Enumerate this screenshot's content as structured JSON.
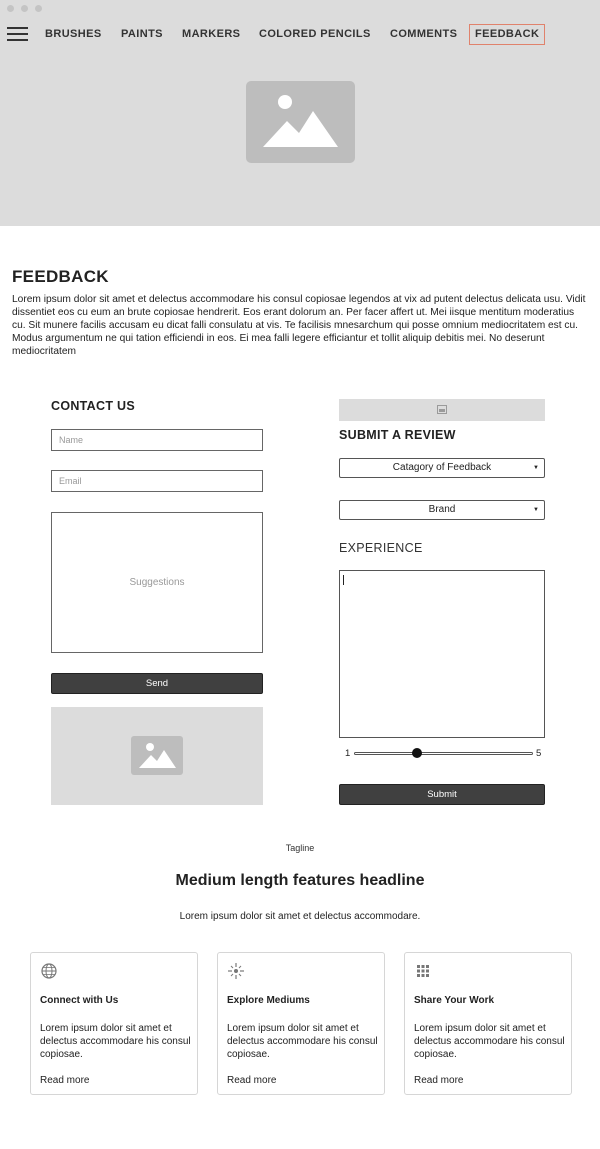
{
  "nav": {
    "items": [
      {
        "label": "BRUSHES"
      },
      {
        "label": "PAINTS"
      },
      {
        "label": "MARKERS"
      },
      {
        "label": "COLORED PENCILS"
      },
      {
        "label": "COMMENTS"
      },
      {
        "label": "FEEDBACK",
        "active": true
      }
    ]
  },
  "page": {
    "title": "FEEDBACK",
    "intro": "Lorem ipsum dolor sit amet et delectus accommodare his consul copiosae legendos at vix ad putent delectus delicata usu. Vidit dissentiet eos cu eum an brute copiosae hendrerit. Eos erant dolorum an. Per facer affert ut. Mei iisque mentitum moderatius cu. Sit munere facilis accusam eu dicat falli consulatu at vis. Te facilisis mnesarchum qui posse omnium mediocritatem est cu. Modus argumentum ne qui tation efficiendi in eos. Ei mea falli legere efficiantur et tollit aliquip debitis mei. No deserunt mediocritatem"
  },
  "contact": {
    "heading": "CONTACT US",
    "name_placeholder": "Name",
    "email_placeholder": "Email",
    "suggestions_placeholder": "Suggestions",
    "send_label": "Send"
  },
  "review": {
    "heading": "SUBMIT A REVIEW",
    "category_select": "Catagory of Feedback",
    "brand_select": "Brand",
    "experience_heading": "EXPERIENCE",
    "rating_min": "1",
    "rating_max": "5",
    "rating_value": 2.4,
    "submit_label": "Submit"
  },
  "features": {
    "tagline": "Tagline",
    "headline": "Medium length features headline",
    "subline": "Lorem ipsum dolor sit amet et delectus accommodare.",
    "cards": [
      {
        "icon": "globe-icon",
        "title": "Connect with Us",
        "text": "Lorem ipsum dolor sit amet et delectus accommodare his consul copiosae.",
        "link": "Read more"
      },
      {
        "icon": "sparkle-icon",
        "title": "Explore Mediums",
        "text": "Lorem ipsum dolor sit amet et delectus accommodare his consul copiosae.",
        "link": "Read more"
      },
      {
        "icon": "grid-icon",
        "title": "Share Your Work",
        "text": "Lorem ipsum dolor sit amet et delectus accommodare his consul copiosae.",
        "link": "Read more"
      }
    ]
  },
  "colors": {
    "active_nav_border": "#e0826c",
    "button_dark": "#404040",
    "placeholder_fill": "#dcdcdc"
  }
}
